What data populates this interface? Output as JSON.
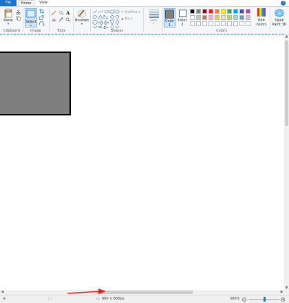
{
  "tabs": {
    "file": "File",
    "home": "Home",
    "view": "View"
  },
  "help": "?",
  "clipboard": {
    "paste_label": "Paste",
    "group_label": "Clipboard"
  },
  "image": {
    "select_label": "Select",
    "group_label": "Image"
  },
  "tools": {
    "group_label": "Tools"
  },
  "brushes": {
    "label": "Brushes"
  },
  "shapes": {
    "outline_label": "Outline",
    "fill_label": "Fill",
    "group_label": "Shapes"
  },
  "size": {
    "label": "Size"
  },
  "color1": {
    "label_line1": "Color",
    "label_line2": "1"
  },
  "color2": {
    "label_line1": "Color",
    "label_line2": "2"
  },
  "colors": {
    "group_label": "Colors",
    "row1": [
      "#000000",
      "#7f7f7f",
      "#880015",
      "#ed1c24",
      "#ff7f27",
      "#fff200",
      "#22b14c",
      "#00a2e8",
      "#3f48cc",
      "#a349a4"
    ],
    "row2": [
      "#ffffff",
      "#c3c3c3",
      "#b97a57",
      "#ffaec9",
      "#ffc90e",
      "#efe4b0",
      "#b5e61d",
      "#99d9ea",
      "#7092be",
      "#c8bfe7"
    ],
    "row3": [
      "#ffffff",
      "#ffffff",
      "#ffffff",
      "#ffffff",
      "#ffffff",
      "#ffffff",
      "#ffffff",
      "#ffffff",
      "#ffffff",
      "#ffffff"
    ]
  },
  "edit_colors": {
    "line1": "Edit",
    "line2": "colors"
  },
  "paint3d": {
    "line1": "Open",
    "line2": "Paint 3D"
  },
  "status": {
    "dimensions": "800 × 800px",
    "zoom": "300%"
  },
  "icons": {
    "drawn_rect_fill": "#7f7f7f",
    "accent": "#1e72c8",
    "arrow_color": "#e02020"
  }
}
